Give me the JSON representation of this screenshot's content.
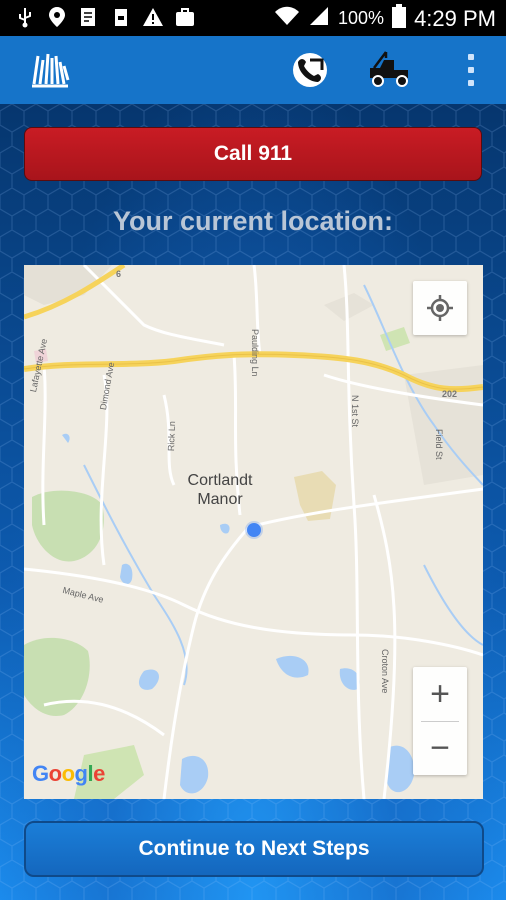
{
  "status_bar": {
    "battery": "100%",
    "time": "4:29 PM",
    "icons": [
      "usb-icon",
      "location-icon",
      "document-icon",
      "storage-icon",
      "warning-icon",
      "briefcase-icon",
      "wifi-icon",
      "signal-icon",
      "battery-icon"
    ]
  },
  "app_bar": {
    "icons": [
      "app-logo-icon",
      "roadside-phone-icon",
      "tow-truck-icon",
      "overflow-menu-icon"
    ]
  },
  "main": {
    "call_button": "Call 911",
    "location_title": "Your current location:",
    "continue_button": "Continue to Next Steps"
  },
  "map": {
    "town": "Cortlandt\nManor",
    "town_line1": "Cortlandt",
    "town_line2": "Manor",
    "road_labels": [
      "Lafayette Ave",
      "Dimond Ave",
      "Rick Ln",
      "Paulding Ln",
      "N 1st St",
      "Field St",
      "Maple Ave",
      "Croton Ave",
      "202",
      "6"
    ],
    "zoom_in": "+",
    "zoom_out": "−",
    "attribution": "Google"
  },
  "colors": {
    "call_red": "#c91c24",
    "appbar_blue": "#1674c9",
    "button_blue": "#1b7ed8",
    "location_dot": "#4285f4",
    "highway_yellow": "#f6d35b"
  }
}
